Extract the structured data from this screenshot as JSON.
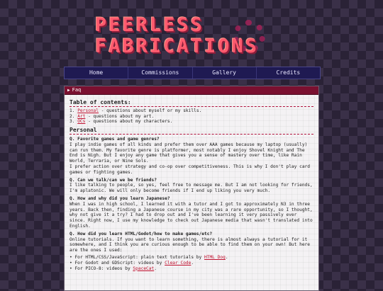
{
  "logo": {
    "line1": "PEERLESS",
    "line2": "FABRICATIONS"
  },
  "nav": [
    "Home",
    "Commissions",
    "Gallery",
    "Credits"
  ],
  "panel": {
    "title": "Faq"
  },
  "toc": {
    "heading": "Table of contents:",
    "items": [
      {
        "num": "1.",
        "link": "Personal",
        "rest": " - questions about myself or my skills."
      },
      {
        "num": "2.",
        "link": "Art",
        "rest": " - questions about my art."
      },
      {
        "num": "3.",
        "link": "OCs",
        "rest": " - questions about my characters."
      }
    ]
  },
  "section": "Personal",
  "qa": [
    {
      "q": "Q. Favorite games and game genres?",
      "a": "I play indie games of all kinds and prefer them over AAA games because my laptop (usually) can run them. My favorite genre is platformer, most notably I enjoy Shovel Knight and The End is Nigh. But I enjoy any game that gives you a sense of mastery over time, like Rain World, Terraria, or Nine Sols.",
      "a2": "I prefer action over strategy and co-op over competitiveness. This is why I don't play card games or fighting games."
    },
    {
      "q": "Q. Can we talk/can we be friends?",
      "a": "I like talking to people, so yes, feel free to message me. But I am not looking for friends, I'm aplatonic. We will only become friends if I end up liking you very much."
    },
    {
      "q": "Q. How and why did you learn Japanese?",
      "a": "When I was in high school, I learned it with a tutor and I got to approximately N3 in three years. Back then, finding a Japanese course in my city was a rare opportunity, so I thought, why not give it a try? I had to drop out and I've been learning it very passively ever since. Right now, I use my knowledge to check out Japanese media that wasn't translated into English."
    },
    {
      "q": "Q. How did you learn HTML/Godot/how to make games/etc?",
      "a": "Online tutorials. If you want to learn something, there is almost always a tutorial for it somewhere, and I think you are curious enough to be able to find them on your own! But here are the ones I used:"
    }
  ],
  "bullets": [
    {
      "pre": "For HTML/CSS/JavaScript: plain text tutorials by ",
      "link": "HTML Dog",
      "post": "."
    },
    {
      "pre": "For Godot and GDScript: videos by ",
      "link": "Clear Code",
      "post": "."
    },
    {
      "pre": "For PICO-8: videos by ",
      "link": "SpaceCat",
      "post": "."
    }
  ]
}
